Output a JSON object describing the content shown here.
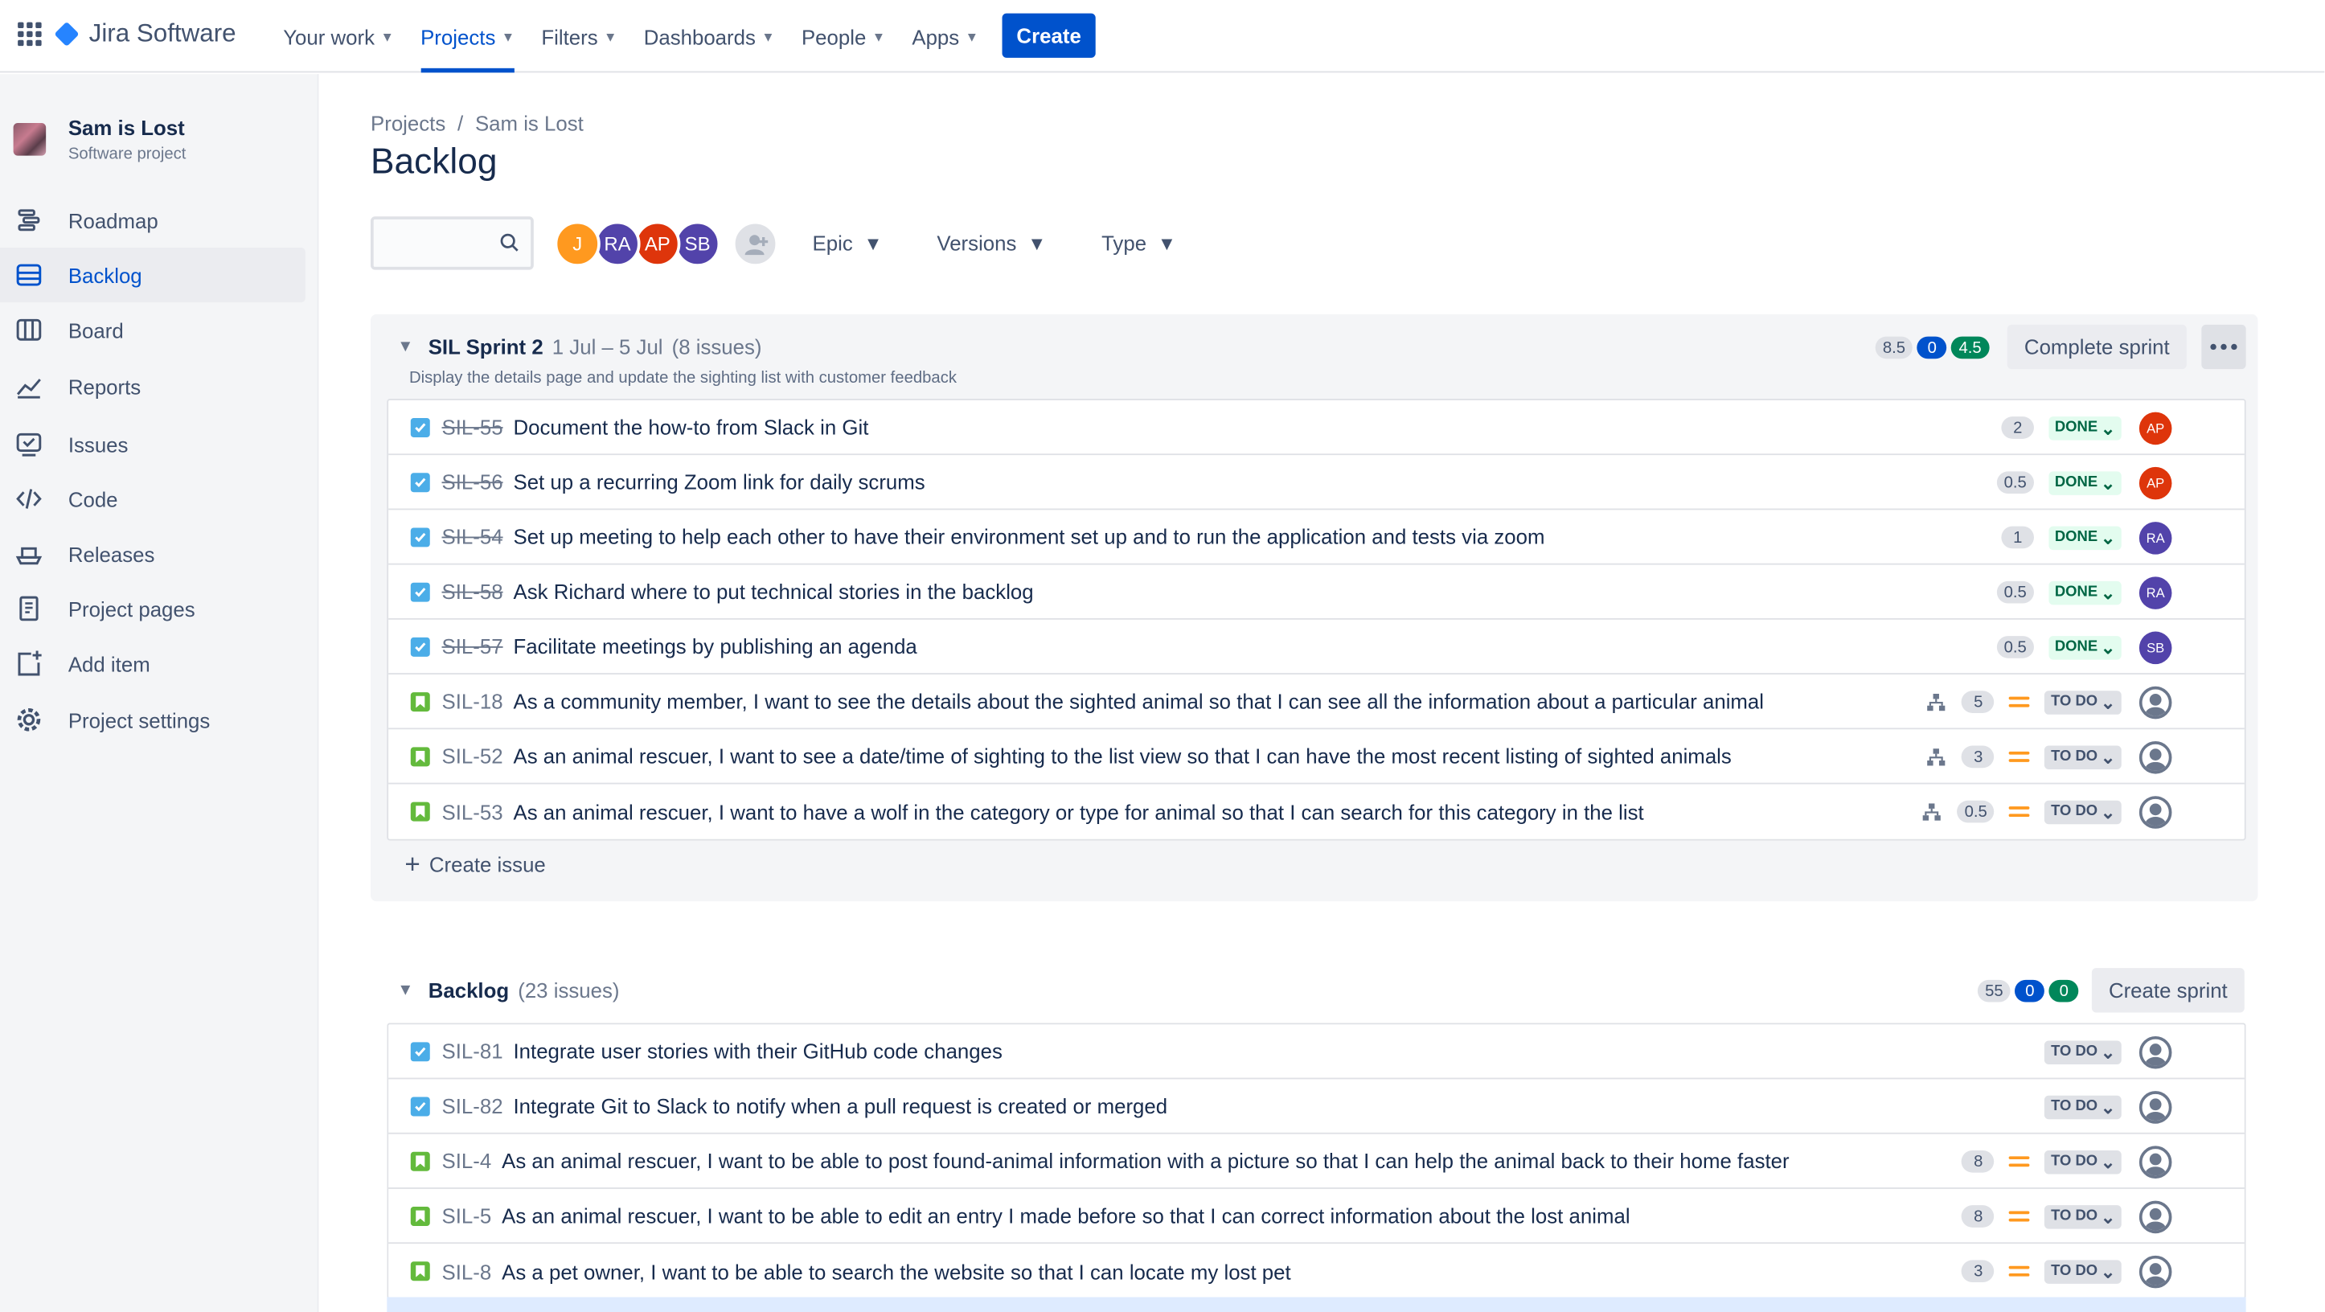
{
  "topbar": {
    "app_name": "Jira Software",
    "nav": [
      {
        "label": "Your work",
        "active": false
      },
      {
        "label": "Projects",
        "active": true
      },
      {
        "label": "Filters",
        "active": false
      },
      {
        "label": "Dashboards",
        "active": false
      },
      {
        "label": "People",
        "active": false
      },
      {
        "label": "Apps",
        "active": false
      }
    ],
    "create_label": "Create"
  },
  "sidebar": {
    "project_name": "Sam is Lost",
    "project_type": "Software project",
    "items": [
      {
        "label": "Roadmap",
        "icon": "roadmap-icon"
      },
      {
        "label": "Backlog",
        "icon": "backlog-icon",
        "active": true
      },
      {
        "label": "Board",
        "icon": "board-icon"
      },
      {
        "label": "Reports",
        "icon": "reports-icon"
      },
      {
        "label": "Issues",
        "icon": "issues-icon"
      },
      {
        "label": "Code",
        "icon": "code-icon"
      },
      {
        "label": "Releases",
        "icon": "releases-icon"
      },
      {
        "label": "Project pages",
        "icon": "pages-icon"
      },
      {
        "label": "Add item",
        "icon": "add-item-icon"
      },
      {
        "label": "Project settings",
        "icon": "gear-icon"
      }
    ]
  },
  "main": {
    "breadcrumb": {
      "root": "Projects",
      "sep": "/",
      "project": "Sam is Lost"
    },
    "title": "Backlog",
    "search_value": "",
    "avatars": [
      {
        "initials": "J",
        "color": "#ff991f"
      },
      {
        "initials": "RA",
        "color": "#5243aa"
      },
      {
        "initials": "AP",
        "color": "#de350b"
      },
      {
        "initials": "SB",
        "color": "#5243aa"
      }
    ],
    "filters": [
      "Epic",
      "Versions",
      "Type"
    ]
  },
  "sprint": {
    "name": "SIL Sprint 2",
    "dates": "1 Jul – 5 Jul",
    "count": "(8 issues)",
    "goal": "Display the details page and update the sighting list with customer feedback",
    "points": {
      "todo": "8.5",
      "in_progress": "0",
      "done": "4.5"
    },
    "complete_label": "Complete sprint",
    "create_issue_label": "Create issue",
    "issues": [
      {
        "type": "task",
        "key": "SIL-55",
        "summary": "Document the how-to from Slack in Git",
        "estimate": "2",
        "status": "DONE",
        "assignee": "AP",
        "assignee_color": "#de350b",
        "done": true
      },
      {
        "type": "task",
        "key": "SIL-56",
        "summary": "Set up a recurring Zoom link for daily scrums",
        "estimate": "0.5",
        "status": "DONE",
        "assignee": "AP",
        "assignee_color": "#de350b",
        "done": true
      },
      {
        "type": "task",
        "key": "SIL-54",
        "summary": "Set up meeting to help each other to have their environment set up and to run the application and tests via zoom",
        "estimate": "1",
        "status": "DONE",
        "assignee": "RA",
        "assignee_color": "#5243aa",
        "done": true
      },
      {
        "type": "task",
        "key": "SIL-58",
        "summary": "Ask Richard where to put technical stories in the backlog",
        "estimate": "0.5",
        "status": "DONE",
        "assignee": "RA",
        "assignee_color": "#5243aa",
        "done": true
      },
      {
        "type": "task",
        "key": "SIL-57",
        "summary": "Facilitate meetings by publishing an agenda",
        "estimate": "0.5",
        "status": "DONE",
        "assignee": "SB",
        "assignee_color": "#5243aa",
        "done": true
      },
      {
        "type": "story",
        "key": "SIL-18",
        "summary": "As a community member, I want to see the details about the sighted animal so that I can see all the information about a particular animal",
        "estimate": "5",
        "status": "TO DO",
        "child": true,
        "priority": "medium"
      },
      {
        "type": "story",
        "key": "SIL-52",
        "summary": "As an animal rescuer, I want to see a date/time of sighting to the list view so that I can have the most recent listing of sighted animals",
        "estimate": "3",
        "status": "TO DO",
        "child": true,
        "priority": "medium"
      },
      {
        "type": "story",
        "key": "SIL-53",
        "summary": "As an animal rescuer, I want to have a wolf in the category or type for animal so that I can search for this category in the list",
        "estimate": "0.5",
        "status": "TO DO",
        "child": true,
        "priority": "medium"
      }
    ]
  },
  "backlog": {
    "name": "Backlog",
    "count": "(23 issues)",
    "points": {
      "todo": "55",
      "in_progress": "0",
      "done": "0"
    },
    "create_sprint_label": "Create sprint",
    "issues": [
      {
        "type": "task",
        "key": "SIL-81",
        "summary": "Integrate user stories with their GitHub code changes",
        "status": "TO DO"
      },
      {
        "type": "task",
        "key": "SIL-82",
        "summary": "Integrate Git to Slack to notify when a pull request is created or merged",
        "status": "TO DO"
      },
      {
        "type": "story",
        "key": "SIL-4",
        "summary": "As an animal rescuer, I want to be able to post found-animal information with a picture so that I can help the animal back to their home faster",
        "estimate": "8",
        "status": "TO DO",
        "priority": "medium"
      },
      {
        "type": "story",
        "key": "SIL-5",
        "summary": "As an animal rescuer, I want to be able to edit an entry I made before so that I can correct information about the lost animal",
        "estimate": "8",
        "status": "TO DO",
        "priority": "medium"
      },
      {
        "type": "story",
        "key": "SIL-8",
        "summary": "As a pet owner, I want to be able to search the website so that I can locate my lost pet",
        "estimate": "3",
        "status": "TO DO",
        "priority": "medium"
      }
    ]
  },
  "colors": {
    "accent": "#0052cc",
    "done": "#00875a",
    "priority_medium": "#ff991f"
  }
}
